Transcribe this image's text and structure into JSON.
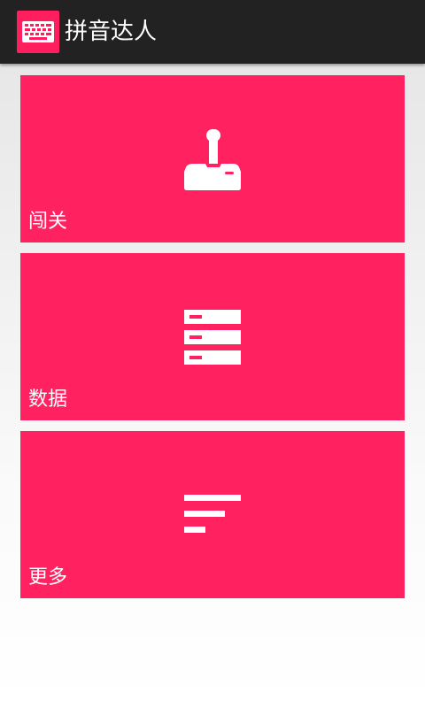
{
  "app": {
    "title": "拼音达人",
    "icon": "keyboard-icon"
  },
  "colors": {
    "action_bar": "#222222",
    "accent": "#ff2160",
    "tile_text": "#ffffff"
  },
  "tiles": [
    {
      "label": "闯关",
      "icon": "joystick-icon"
    },
    {
      "label": "数据",
      "icon": "server-stack-icon"
    },
    {
      "label": "更多",
      "icon": "sort-lines-icon"
    }
  ]
}
